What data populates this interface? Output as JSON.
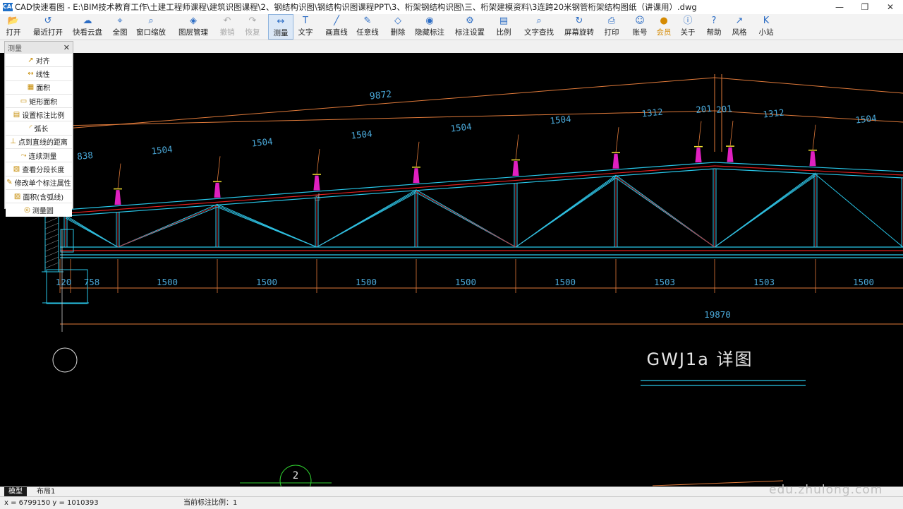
{
  "window": {
    "title": "CAD快速看图 - E:\\BIM技术教育工作\\土建工程师课程\\建筑识图课程\\2、钢结构识图\\钢结构识图课程PPT\\3、桁架钢结构识图\\三、桁架建模资料\\3连跨20米钢管桁架结构图纸（讲课用）.dwg",
    "app_icon_text": "CAD"
  },
  "toolbar": [
    {
      "label": "打开",
      "icon": "open-folder-icon"
    },
    {
      "label": "最近打开",
      "icon": "recent-clock-icon"
    },
    {
      "label": "快看云盘",
      "icon": "cloud-icon"
    },
    {
      "label": "全图",
      "icon": "fit-all-icon"
    },
    {
      "label": "窗口缩放",
      "icon": "zoom-window-icon"
    },
    {
      "label": "图层管理",
      "icon": "layers-icon"
    },
    {
      "label": "撤销",
      "icon": "undo-icon",
      "disabled": true
    },
    {
      "label": "恢复",
      "icon": "redo-icon",
      "disabled": true
    },
    {
      "label": "测量",
      "icon": "measure-icon",
      "active": true
    },
    {
      "label": "文字",
      "icon": "text-icon"
    },
    {
      "label": "画直线",
      "icon": "line-icon"
    },
    {
      "label": "任意线",
      "icon": "freehand-icon"
    },
    {
      "label": "删除",
      "icon": "eraser-icon"
    },
    {
      "label": "隐藏标注",
      "icon": "hide-eye-icon"
    },
    {
      "label": "标注设置",
      "icon": "annotation-settings-icon"
    },
    {
      "label": "比例",
      "icon": "scale-icon"
    },
    {
      "label": "文字查找",
      "icon": "text-search-icon"
    },
    {
      "label": "屏幕旋转",
      "icon": "rotate-icon"
    },
    {
      "label": "打印",
      "icon": "printer-icon"
    },
    {
      "label": "账号",
      "icon": "user-icon"
    },
    {
      "label": "会员",
      "icon": "vip-icon",
      "vip": true
    },
    {
      "label": "关于",
      "icon": "info-icon"
    },
    {
      "label": "帮助",
      "icon": "help-icon"
    },
    {
      "label": "风格",
      "icon": "style-icon"
    },
    {
      "label": "小站",
      "icon": "k-station-icon"
    }
  ],
  "measure_panel": {
    "title": "测量",
    "items": [
      "对齐",
      "线性",
      "面积",
      "矩形面积",
      "设置标注比例",
      "弧长",
      "点到直线的距离",
      "连续测量",
      "查看分段长度",
      "修改单个标注属性",
      "面积(含弧线)",
      "测量圆"
    ]
  },
  "drawing": {
    "top_span": "9872",
    "upper_dims": [
      "838",
      "1504",
      "1504",
      "1504",
      "1504",
      "1504",
      "1312",
      "201",
      "201",
      "1312",
      "1504"
    ],
    "lower_dims": [
      "120",
      "758",
      "1500",
      "1500",
      "1500",
      "1500",
      "1500",
      "1503",
      "1503",
      "1500"
    ],
    "total_dim": "19870",
    "detail_title": "GWJ1a 详图",
    "callout": "2"
  },
  "bottom_tabs": [
    "模型",
    "布局1"
  ],
  "status": {
    "coords": "x = 6799150  y = 1010393",
    "scale": "当前标注比例：1"
  },
  "watermark": "edu.zhulong.com",
  "colors": {
    "canvas_bg": "#000000",
    "chord_cyan": "#28c6e8",
    "red": "#e02020",
    "dim_orange": "#e07a3a",
    "dim_text": "#4aa8d8",
    "magenta": "#e020c0",
    "yellow": "#f0e030"
  }
}
